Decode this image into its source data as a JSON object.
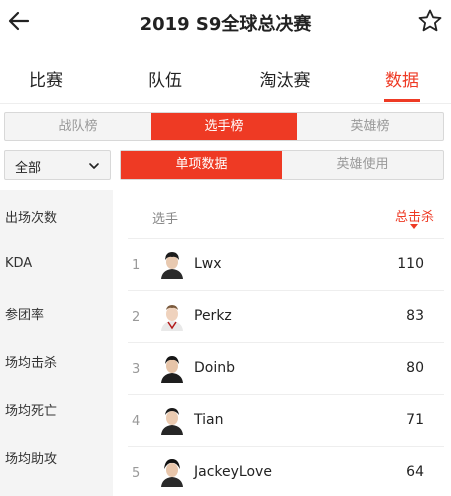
{
  "header": {
    "title": "2019 S9全球总决赛",
    "back_icon": "back-arrow-icon",
    "star_icon": "star-outline-icon"
  },
  "main_tabs": [
    {
      "label": "比赛",
      "active": false
    },
    {
      "label": "队伍",
      "active": false
    },
    {
      "label": "淘汰赛",
      "active": false
    },
    {
      "label": "数据",
      "active": true
    }
  ],
  "ranking_tabs": [
    {
      "label": "战队榜",
      "active": false
    },
    {
      "label": "选手榜",
      "active": true
    },
    {
      "label": "英雄榜",
      "active": false
    }
  ],
  "filter": {
    "selected": "全部",
    "icon": "chevron-down-icon"
  },
  "stat_tabs": [
    {
      "label": "单项数据",
      "active": true
    },
    {
      "label": "英雄使用",
      "active": false
    }
  ],
  "sidebar": {
    "items": [
      "出场次数",
      "KDA",
      "参团率",
      "场均击杀",
      "场均死亡",
      "场均助攻"
    ]
  },
  "table": {
    "col_player": "选手",
    "col_stat": "总击杀",
    "rows": [
      {
        "rank": "1",
        "name": "Lwx",
        "value": "110"
      },
      {
        "rank": "2",
        "name": "Perkz",
        "value": "83"
      },
      {
        "rank": "3",
        "name": "Doinb",
        "value": "80"
      },
      {
        "rank": "4",
        "name": "Tian",
        "value": "71"
      },
      {
        "rank": "5",
        "name": "JackeyLove",
        "value": "64"
      }
    ]
  },
  "colors": {
    "accent": "#ee3a24",
    "segment_bg": "#f4f4f4",
    "sidebar_bg": "#f4f4f4"
  }
}
